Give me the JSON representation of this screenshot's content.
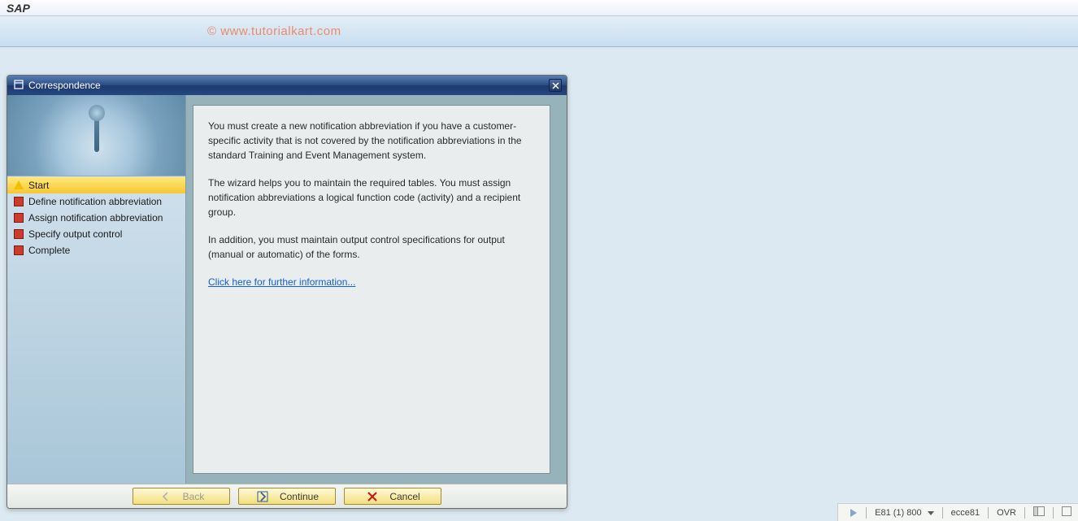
{
  "app": {
    "title": "SAP"
  },
  "watermark": "© www.tutorialkart.com",
  "dialog": {
    "title": "Correspondence",
    "close_tooltip": "Close",
    "steps": [
      {
        "label": "Start",
        "state": "active"
      },
      {
        "label": "Define notification abbreviation",
        "state": "pending"
      },
      {
        "label": "Assign notification abbreviation",
        "state": "pending"
      },
      {
        "label": "Specify output control",
        "state": "pending"
      },
      {
        "label": "Complete",
        "state": "pending"
      }
    ],
    "content": {
      "p1": "You must create a new notification abbreviation if you have a customer-specific activity that is not covered by the notification abbreviations in the standard Training and Event Management system.",
      "p2": "The wizard helps you to maintain the required tables. You must assign notification abbreviations a logical function code (activity) and a recipient group.",
      "p3": "In addition, you must maintain output control specifications for output (manual or automatic) of the forms.",
      "link_text": "Click here for further information..."
    },
    "buttons": {
      "back": "Back",
      "continue": "Continue",
      "cancel": "Cancel"
    }
  },
  "statusbar": {
    "session": "E81 (1) 800",
    "server": "ecce81",
    "mode": "OVR"
  }
}
